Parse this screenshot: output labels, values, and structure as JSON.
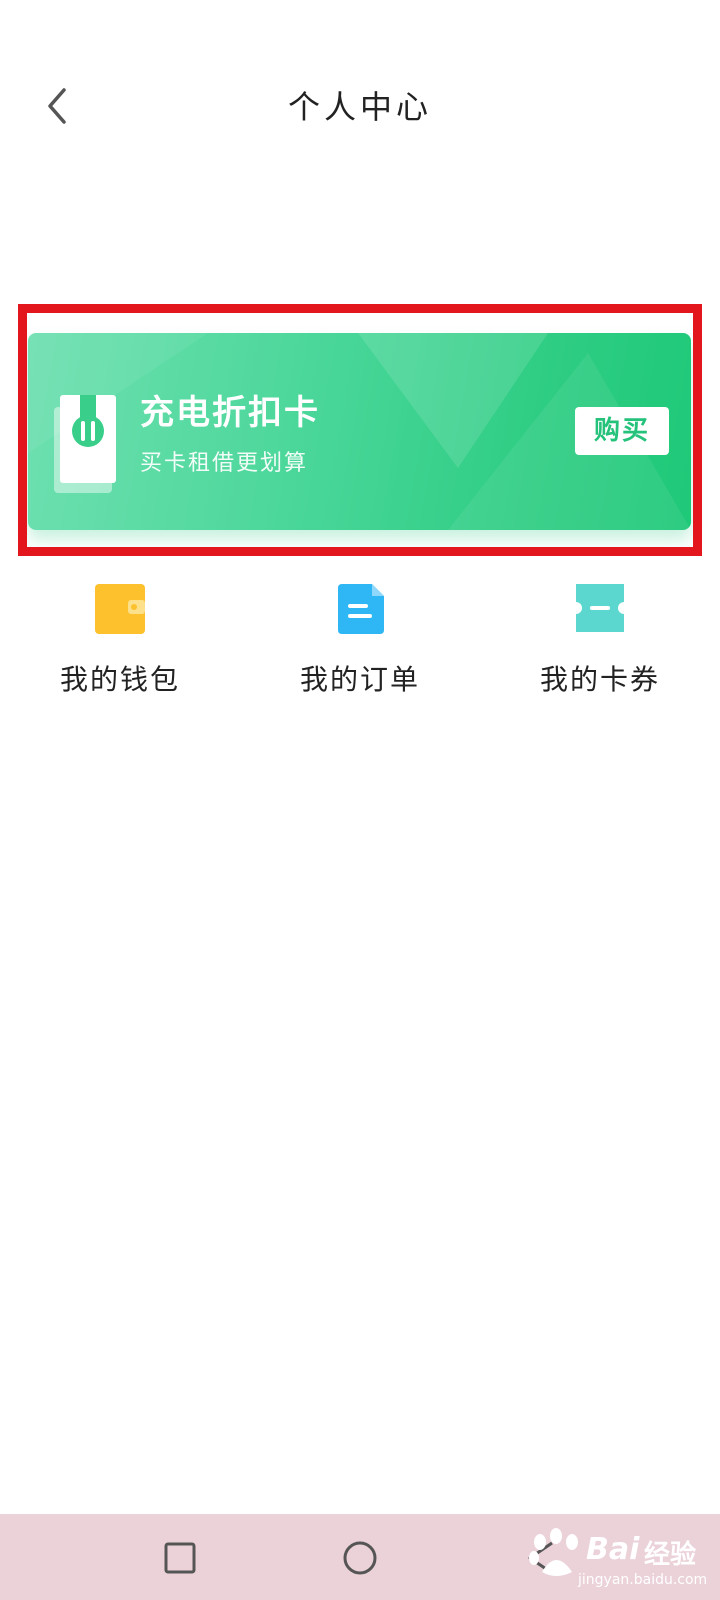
{
  "header": {
    "title": "个人中心",
    "back_icon": "chevron-left-icon"
  },
  "promo_card": {
    "title": "充电折扣卡",
    "subtitle": "买卡租借更划算",
    "buy_label": "购买",
    "accent_color": "#2fcd84"
  },
  "quick_entries": [
    {
      "label": "我的钱包",
      "icon": "wallet-icon",
      "color": "#fcc12d"
    },
    {
      "label": "我的订单",
      "icon": "document-icon",
      "color": "#2fb6f5"
    },
    {
      "label": "我的卡券",
      "icon": "ticket-icon",
      "color": "#5cd7cf"
    }
  ],
  "nav_bar": {
    "background": "#ebd2d9",
    "buttons": [
      "recent-apps-icon",
      "home-icon",
      "back-icon"
    ]
  },
  "watermark": {
    "brand": "Bai",
    "brand_cn": "经验",
    "url": "jingyan.baidu.com"
  }
}
